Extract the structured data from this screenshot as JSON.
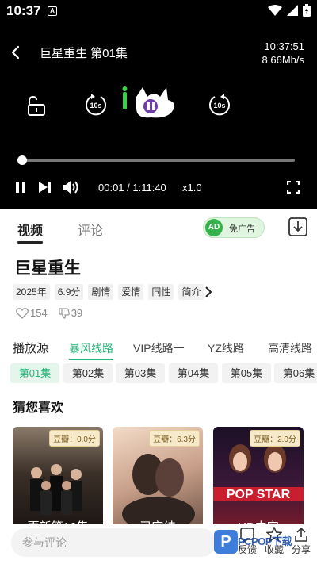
{
  "status_bar": {
    "time": "10:37",
    "notif": "A"
  },
  "player": {
    "title": "巨星重生 第01集",
    "clock": "10:37:51",
    "speed_rate": "8.66Mb/s",
    "rewind_label": "10s",
    "forward_label": "10s",
    "time_display": "00:01 / 1:11:40",
    "playback_speed": "x1.0",
    "progress": 0.012
  },
  "tabs": {
    "video": "视频",
    "comment": "评论"
  },
  "ad_pill": {
    "badge": "AD",
    "label": "免广告"
  },
  "show": {
    "title": "巨星重生",
    "tags": [
      "2025年",
      "6.9分",
      "剧情",
      "爱情",
      "同性",
      "简介"
    ],
    "likes": "154",
    "dislikes": "39"
  },
  "sources": {
    "label": "播放源",
    "items": [
      "暴风线路",
      "VIP线路一",
      "YZ线路",
      "高清线路"
    ],
    "active_index": 0
  },
  "episodes": [
    "第01集",
    "第02集",
    "第03集",
    "第04集",
    "第05集",
    "第06集"
  ],
  "recommend": {
    "title": "猜您喜欢",
    "cards": [
      {
        "score": "豆瓣：0.0分",
        "caption": "更新第16集"
      },
      {
        "score": "豆瓣：6.3分",
        "caption": "已完结"
      },
      {
        "score": "豆瓣：2.0分",
        "caption": "HD中字"
      }
    ]
  },
  "bottom_bar": {
    "comment_placeholder": "参与评论",
    "feedback": "反馈",
    "favorite": "收藏",
    "share": "分享"
  },
  "watermark": {
    "text": "PCPOP下载"
  },
  "colors": {
    "accent": "#2ab57a",
    "player_bg": "#000000"
  }
}
